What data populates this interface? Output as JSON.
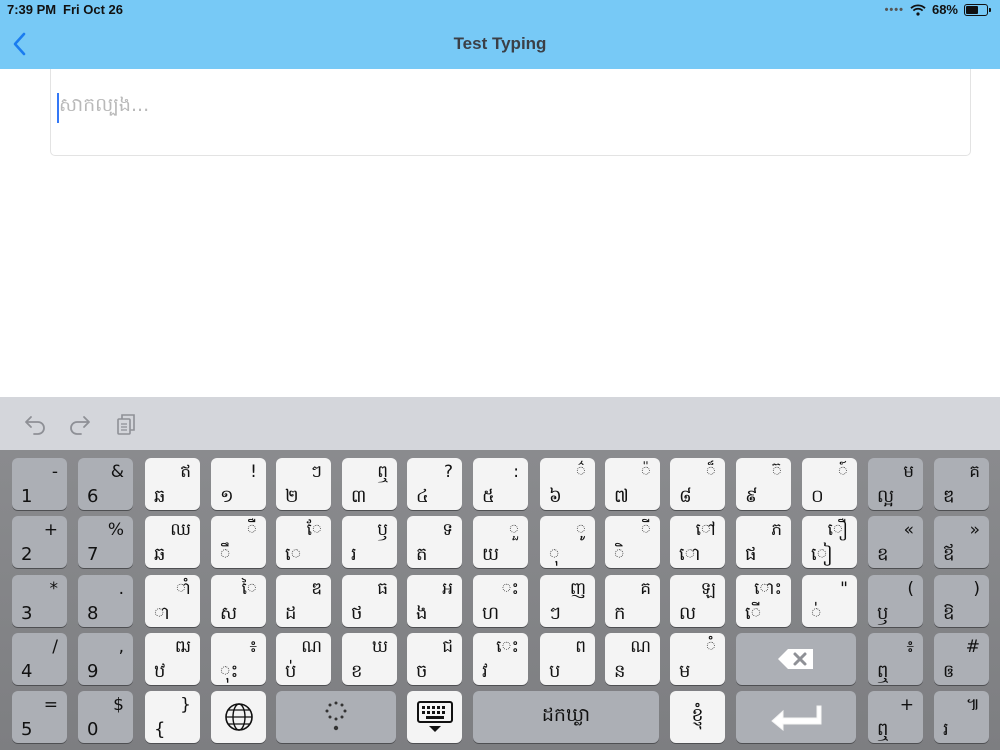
{
  "status": {
    "time": "7:39 PM",
    "date": "Fri Oct 26",
    "battery": "68%",
    "battery_level": 0.68,
    "dots": "••••"
  },
  "nav": {
    "title": "Test Typing",
    "back_icon": "chevron-left-icon"
  },
  "input": {
    "placeholder": "សាកល្បង...",
    "value": ""
  },
  "toolbar": {
    "icons": [
      "undo-icon",
      "redo-icon",
      "clipboard-icon"
    ]
  },
  "colors": {
    "bar": "#77c9f6",
    "caret": "#3478f6",
    "key_light": "#f4f4f4",
    "key_dark": "#acafb5",
    "keyboard_bg": "#848588",
    "toolbar_bg": "#d4d6db"
  },
  "keyboard": {
    "rows": [
      [
        {
          "p": "1",
          "s": "-",
          "style": "dark"
        },
        {
          "p": "6",
          "s": "&",
          "style": "dark"
        },
        {
          "p": "ឆ",
          "s": "ឥ",
          "style": "light"
        },
        {
          "p": "១",
          "s": "!",
          "style": "light"
        },
        {
          "p": "២",
          "s": "ៗ",
          "style": "light"
        },
        {
          "p": "៣",
          "s": "ឮ",
          "style": "light"
        },
        {
          "p": "៤",
          "s": "?",
          "style": "light"
        },
        {
          "p": "៥",
          "s": ":",
          "style": "light"
        },
        {
          "p": "៦",
          "s": "៌",
          "style": "light"
        },
        {
          "p": "៧",
          "s": "៉",
          "style": "light"
        },
        {
          "p": "៨",
          "s": "៏",
          "style": "light"
        },
        {
          "p": "៩",
          "s": "៊",
          "style": "light"
        },
        {
          "p": "០",
          "s": "៍",
          "style": "light"
        },
        {
          "p": "ល្អ",
          "s": "ម",
          "style": "dark"
        },
        {
          "p": "ឌ",
          "s": "គ",
          "style": "dark"
        }
      ],
      [
        {
          "p": "2",
          "s": "+",
          "style": "dark"
        },
        {
          "p": "7",
          "s": "%",
          "style": "dark"
        },
        {
          "p": "ឆ",
          "s": "ឈ",
          "style": "light"
        },
        {
          "p": "ឹ",
          "s": "ឺ",
          "style": "light"
        },
        {
          "p": "េ",
          "s": "ែ",
          "style": "light"
        },
        {
          "p": "រ",
          "s": "ឫ",
          "style": "light"
        },
        {
          "p": "ត",
          "s": "ទ",
          "style": "light"
        },
        {
          "p": "យ",
          "s": "ួ",
          "style": "light"
        },
        {
          "p": "ុ",
          "s": "ូ",
          "style": "light"
        },
        {
          "p": "ិ",
          "s": "ី",
          "style": "light"
        },
        {
          "p": "ោ",
          "s": "ៅ",
          "style": "light"
        },
        {
          "p": "ផ",
          "s": "ភ",
          "style": "light"
        },
        {
          "p": "ៀ",
          "s": "ឿ",
          "style": "light"
        },
        {
          "p": "ឧ",
          "s": "«",
          "style": "dark"
        },
        {
          "p": "ឪ",
          "s": "»",
          "style": "dark"
        }
      ],
      [
        {
          "p": "3",
          "s": "*",
          "style": "dark"
        },
        {
          "p": "8",
          "s": ".",
          "style": "dark"
        },
        {
          "p": "ា",
          "s": "ាំ",
          "style": "light"
        },
        {
          "p": "ស",
          "s": "ៃ",
          "style": "light"
        },
        {
          "p": "ដ",
          "s": "ឌ",
          "style": "light"
        },
        {
          "p": "ថ",
          "s": "ធ",
          "style": "light"
        },
        {
          "p": "ង",
          "s": "អ",
          "style": "light"
        },
        {
          "p": "ហ",
          "s": "ះ",
          "style": "light"
        },
        {
          "p": "ៗ",
          "s": "ញ",
          "style": "light"
        },
        {
          "p": "ក",
          "s": "គ",
          "style": "light"
        },
        {
          "p": "ល",
          "s": "ឡ",
          "style": "light"
        },
        {
          "p": "ើ",
          "s": "ោះ",
          "style": "light"
        },
        {
          "p": "់",
          "s": "\"",
          "style": "light"
        },
        {
          "p": "ឫ",
          "s": "(",
          "style": "dark"
        },
        {
          "p": "ឱ",
          "s": ")",
          "style": "dark"
        }
      ],
      [
        {
          "p": "4",
          "s": "/",
          "style": "dark"
        },
        {
          "p": "9",
          "s": ",",
          "style": "dark"
        },
        {
          "p": "ឋ",
          "s": "ឍ",
          "style": "light"
        },
        {
          "p": "ុះ",
          "s": "៖",
          "style": "light"
        },
        {
          "p": "ប់",
          "s": "ណ",
          "style": "light"
        },
        {
          "p": "ខ",
          "s": "ឃ",
          "style": "light"
        },
        {
          "p": "ច",
          "s": "ជ",
          "style": "light"
        },
        {
          "p": "វ",
          "s": "េះ",
          "style": "light"
        },
        {
          "p": "ប",
          "s": "ព",
          "style": "light"
        },
        {
          "p": "ន",
          "s": "ណ",
          "style": "light"
        },
        {
          "p": "ម",
          "s": "ំ",
          "style": "light"
        },
        {
          "p": "ឮ",
          "s": "៖",
          "style": "dark"
        },
        {
          "p": "ឲ",
          "s": "#",
          "style": "dark"
        }
      ],
      [
        {
          "p": "5",
          "s": "=",
          "style": "dark"
        },
        {
          "p": "0",
          "s": "$",
          "style": "dark"
        },
        {
          "p": "{",
          "s": "}",
          "style": "light"
        },
        {
          "icon": "globe-icon",
          "style": "light"
        },
        {
          "icon": "space-dots-icon",
          "style": "dark"
        },
        {
          "icon": "keyboard-hide-icon",
          "style": "light"
        },
        {
          "label": "ដកឃ្លា",
          "style": "dark"
        },
        {
          "label": "ខ្ញុំ",
          "style": "light"
        },
        {
          "icon": "return-icon",
          "style": "dark"
        },
        {
          "p": "ឮ",
          "s": "+",
          "style": "dark"
        },
        {
          "p": "រ",
          "s": "៕",
          "style": "dark"
        }
      ]
    ]
  }
}
